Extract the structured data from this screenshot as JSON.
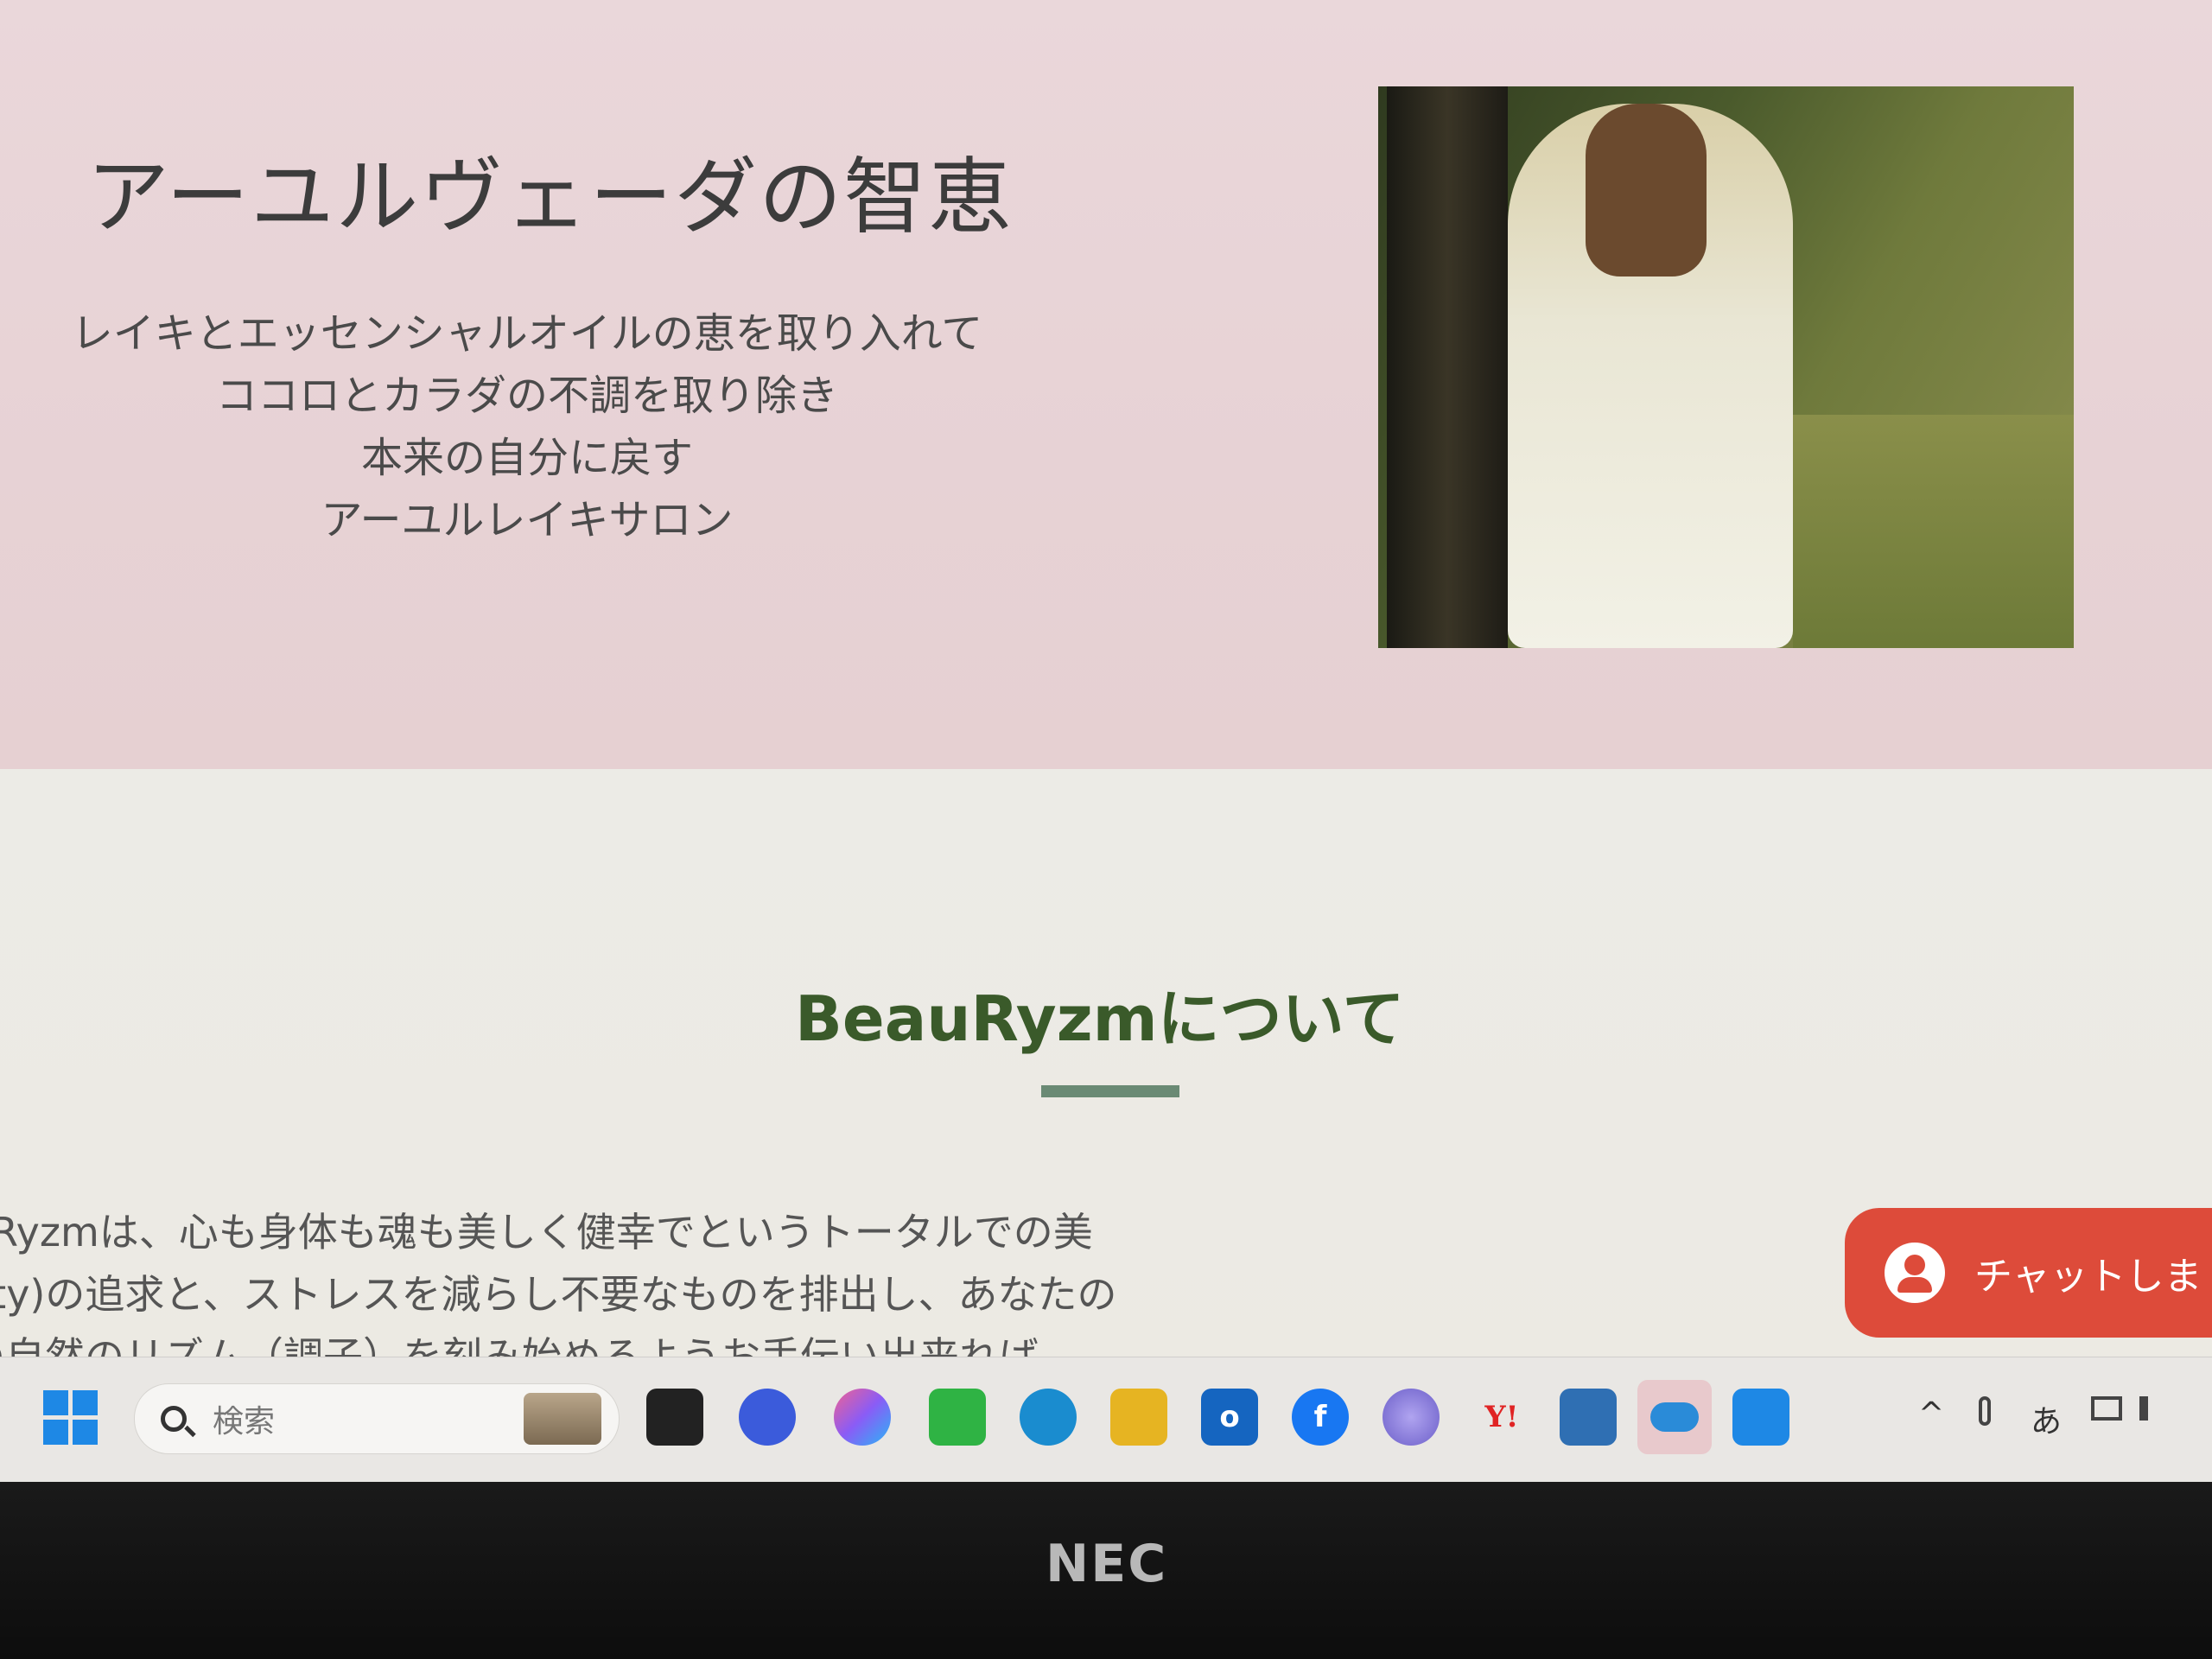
{
  "hero": {
    "title": "アーユルヴェーダの智恵",
    "lines": [
      "レイキとエッセンシャルオイルの恵を取り入れて",
      "ココロとカラダの不調を取り除き",
      "本来の自分に戻す",
      "アーユルレイキサロン"
    ]
  },
  "about": {
    "title": "BeauRyzmについて",
    "body": [
      "uRyzmは、心も身体も魂も美しく健幸でというトータルでの美",
      "uty)の追求と、ストレスを減らし不要なものを排出し、あなたの",
      "の自然のリズム（調子）を刻み始めるようお手伝い出来れば"
    ]
  },
  "chat": {
    "label": "チャットしま"
  },
  "taskbar": {
    "search_placeholder": "検索",
    "icons": [
      {
        "name": "task-view-icon",
        "color": "#222222"
      },
      {
        "name": "meet-icon",
        "color": "#3b5bdb"
      },
      {
        "name": "copilot-icon",
        "color": "#8a5cf6"
      },
      {
        "name": "line-icon",
        "color": "#2fb344"
      },
      {
        "name": "edge-icon",
        "color": "#1a8ccf"
      },
      {
        "name": "file-explorer-icon",
        "color": "#e6b422"
      },
      {
        "name": "outlook-icon",
        "color": "#1565c0"
      },
      {
        "name": "facebook-icon",
        "color": "#1877f2"
      },
      {
        "name": "app-orb-icon",
        "color": "#7a6fd6"
      },
      {
        "name": "yahoo-icon",
        "color": "#e02424"
      },
      {
        "name": "notepad-icon",
        "color": "#2f6fb3"
      },
      {
        "name": "onedrive-icon",
        "color": "#2a8bd8"
      },
      {
        "name": "photos-icon",
        "color": "#1e88e5"
      }
    ],
    "yahoo_label": "Y!",
    "facebook_label": "f",
    "outlook_label": "o",
    "tray": {
      "chevron": "^",
      "ime": "あ"
    }
  },
  "brand": "NEC"
}
